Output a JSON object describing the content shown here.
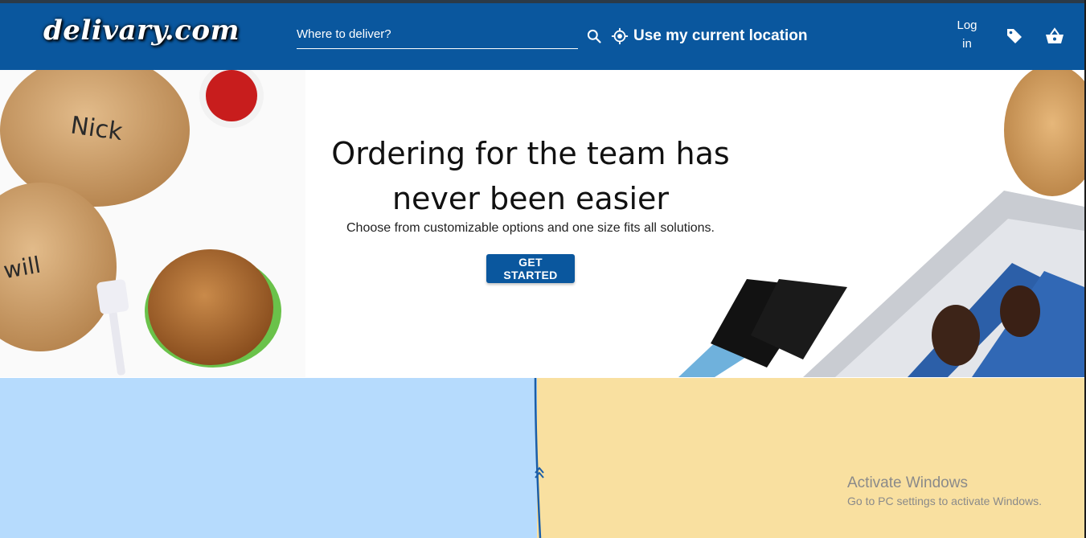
{
  "header": {
    "logo_text": "delivary.com",
    "search": {
      "placeholder": "Where to deliver?",
      "value": ""
    },
    "location_label": "Use my current location",
    "login_line1": "Log",
    "login_line2": "in",
    "brand_color": "#0a579e",
    "icons": [
      "search-icon",
      "crosshair-icon",
      "tag-icon",
      "basket-icon"
    ]
  },
  "hero": {
    "title_line1": "Ordering for the team has",
    "title_line2": "never been easier",
    "subtitle": "Choose from customizable options and one size fits all solutions.",
    "cta_label": "GET STARTED",
    "bag_label_1": "Nick",
    "bag_label_2": "will"
  },
  "panels": {
    "left_color": "#b6dbfd",
    "right_color": "#f9e0a0"
  },
  "watermark": {
    "title": "Activate Windows",
    "subtitle": "Go to PC settings to activate Windows."
  }
}
